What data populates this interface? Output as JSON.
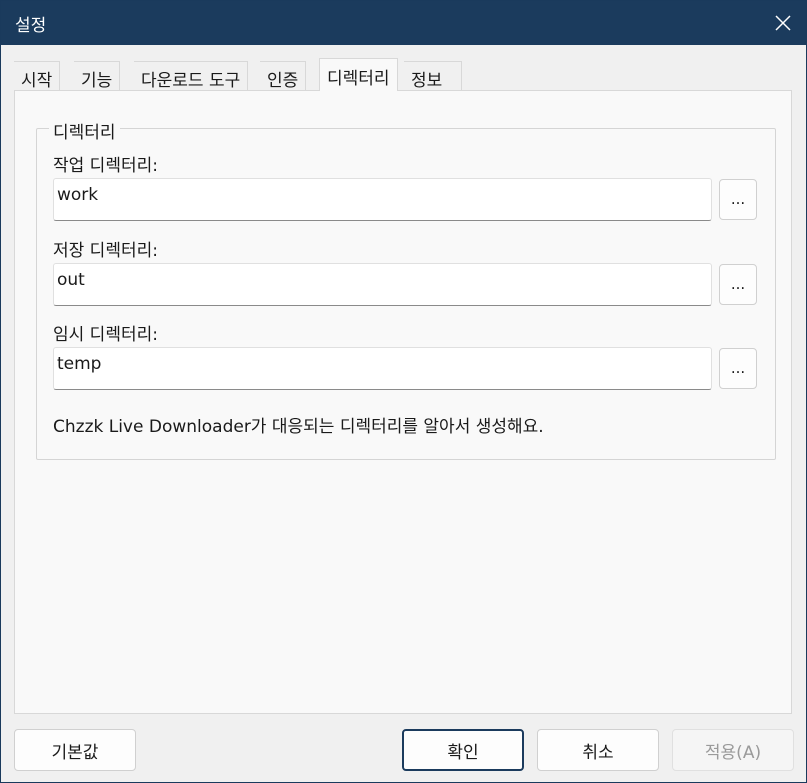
{
  "window": {
    "title": "설정",
    "close_icon": "close-icon"
  },
  "tabs": [
    {
      "label": "시작"
    },
    {
      "label": "기능"
    },
    {
      "label": "다운로드 도구"
    },
    {
      "label": "인증"
    },
    {
      "label": "디렉터리",
      "active": true
    },
    {
      "label": "정보"
    }
  ],
  "directory_group": {
    "title": "디렉터리",
    "work": {
      "label": "작업 디렉터리:",
      "value": "work",
      "browse_label": "..."
    },
    "out": {
      "label": "저장 디렉터리:",
      "value": "out",
      "browse_label": "..."
    },
    "temp": {
      "label": "임시 디렉터리:",
      "value": "temp",
      "browse_label": "..."
    },
    "info": "Chzzk Live Downloader가 대응되는 디렉터리를 알아서 생성해요."
  },
  "buttons": {
    "defaults": "기본값",
    "ok": "확인",
    "cancel": "취소",
    "apply": "적용(A)"
  },
  "colors": {
    "titlebar": "#1b3b5d",
    "panel": "#f9f9f9",
    "window_bg": "#f0f0f0"
  }
}
